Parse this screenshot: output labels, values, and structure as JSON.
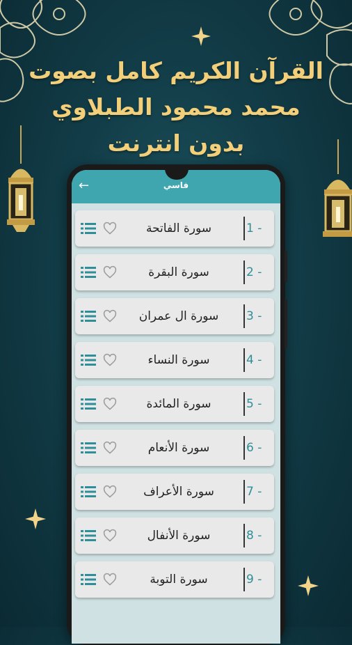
{
  "headline": {
    "line1": "القرآن الكريم كامل بصوت",
    "line2": "محمد محمود الطبلاوي",
    "line3": "بدون انترنت"
  },
  "app": {
    "title": "فاسي",
    "back_icon": "arrow-left-icon"
  },
  "colors": {
    "accent": "#3fa6b0",
    "number": "#2f8f99",
    "gold": "#f3cf7a",
    "background": "#123d48"
  },
  "surahs": [
    {
      "number": "1 -",
      "name": "سورة الفاتحة"
    },
    {
      "number": "2 -",
      "name": "سورة البقرة"
    },
    {
      "number": "3 -",
      "name": "سورة ال عمران"
    },
    {
      "number": "4 -",
      "name": "سورة النساء"
    },
    {
      "number": "5 -",
      "name": "سورة المائدة"
    },
    {
      "number": "6 -",
      "name": "سورة الأنعام"
    },
    {
      "number": "7 -",
      "name": "سورة الأعراف"
    },
    {
      "number": "8 -",
      "name": "سورة الأنفال"
    },
    {
      "number": "9 -",
      "name": "سورة التوبة"
    }
  ]
}
